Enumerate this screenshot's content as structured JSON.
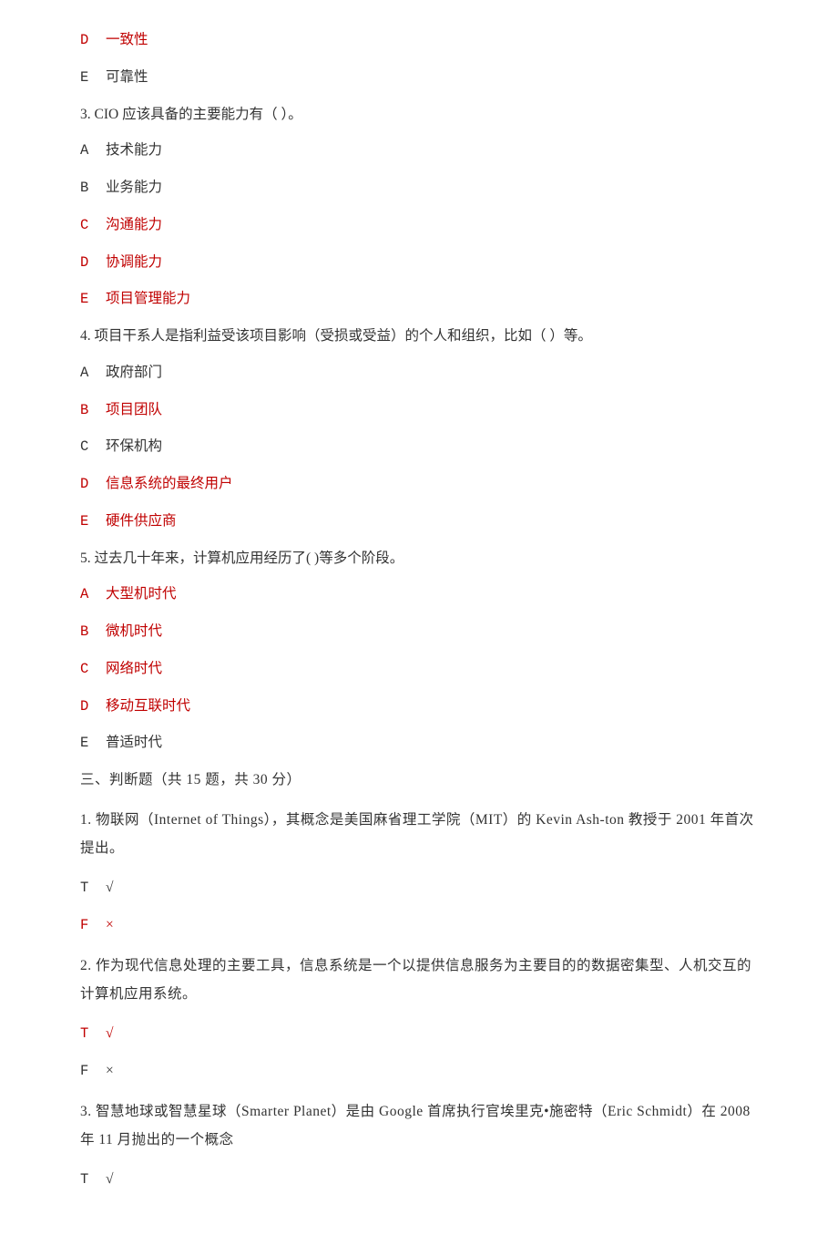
{
  "q2": {
    "options": [
      {
        "marker": "D",
        "text": "一致性",
        "color": "red"
      },
      {
        "marker": "E",
        "text": "可靠性",
        "color": "black"
      }
    ]
  },
  "q3": {
    "number": "3.",
    "stem": "CIO 应该具备的主要能力有（ ）。",
    "options": [
      {
        "marker": "A",
        "text": "技术能力",
        "color": "black"
      },
      {
        "marker": "B",
        "text": "业务能力",
        "color": "black"
      },
      {
        "marker": "C",
        "text": "沟通能力",
        "color": "red"
      },
      {
        "marker": "D",
        "text": "协调能力",
        "color": "red"
      },
      {
        "marker": "E",
        "text": "项目管理能力",
        "color": "red"
      }
    ]
  },
  "q4": {
    "number": "4.",
    "stem": "项目干系人是指利益受该项目影响（受损或受益）的个人和组织，比如（ ）等。",
    "options": [
      {
        "marker": "A",
        "text": "政府部门",
        "color": "black"
      },
      {
        "marker": "B",
        "text": "项目团队",
        "color": "red"
      },
      {
        "marker": "C",
        "text": "环保机构",
        "color": "black"
      },
      {
        "marker": "D",
        "text": "信息系统的最终用户",
        "color": "red"
      },
      {
        "marker": "E",
        "text": "硬件供应商",
        "color": "red"
      }
    ]
  },
  "q5": {
    "number": "5.",
    "stem": "过去几十年来，计算机应用经历了( )等多个阶段。",
    "options": [
      {
        "marker": "A",
        "text": "大型机时代",
        "color": "red"
      },
      {
        "marker": "B",
        "text": "微机时代",
        "color": "red"
      },
      {
        "marker": "C",
        "text": "网络时代",
        "color": "red"
      },
      {
        "marker": "D",
        "text": "移动互联时代",
        "color": "red"
      },
      {
        "marker": "E",
        "text": "普适时代",
        "color": "black"
      }
    ]
  },
  "section3": {
    "heading": "三、判断题（共 15 题，共 30 分）"
  },
  "j1": {
    "number": "1.",
    "stem": "物联网（Internet of Things），其概念是美国麻省理工学院（MIT）的 Kevin Ash-ton 教授于 2001 年首次提出。",
    "options": [
      {
        "marker": "T",
        "symbol": "√",
        "color": "black"
      },
      {
        "marker": "F",
        "symbol": "×",
        "color": "red"
      }
    ]
  },
  "j2": {
    "number": "2.",
    "stem": "作为现代信息处理的主要工具，信息系统是一个以提供信息服务为主要目的的数据密集型、人机交互的计算机应用系统。",
    "options": [
      {
        "marker": "T",
        "symbol": "√",
        "color": "red"
      },
      {
        "marker": "F",
        "symbol": "×",
        "color": "black"
      }
    ]
  },
  "j3": {
    "number": "3.",
    "stem": "智慧地球或智慧星球（Smarter Planet）是由 Google 首席执行官埃里克•施密特（Eric Schmidt）在 2008 年 11 月抛出的一个概念",
    "options": [
      {
        "marker": "T",
        "symbol": "√",
        "color": "black"
      }
    ]
  }
}
